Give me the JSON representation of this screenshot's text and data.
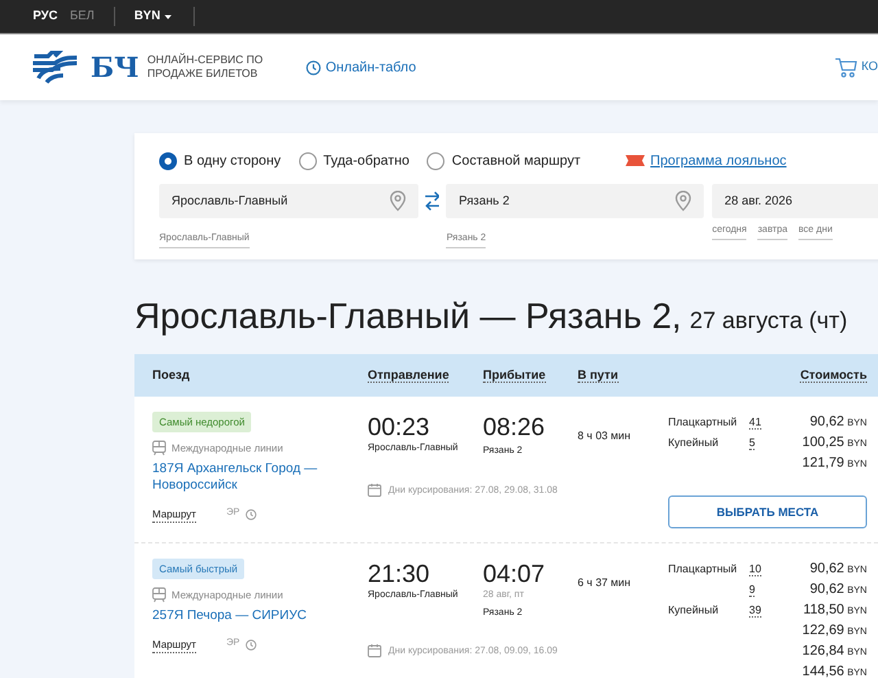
{
  "topbar": {
    "languages": [
      {
        "label": "РУС",
        "selected": true
      },
      {
        "label": "БЕЛ",
        "selected": false
      }
    ],
    "currency": "BYN"
  },
  "header": {
    "logo_text": "БЧ",
    "service": "ОНЛАЙН-СЕРВИС ПО ПРОДАЖЕ БИЛЕТОВ",
    "board_link": "Онлайн-табло",
    "cart": "КО"
  },
  "search": {
    "trip_types": [
      {
        "label": "В одну сторону",
        "selected": true
      },
      {
        "label": "Туда-обратно",
        "selected": false
      },
      {
        "label": "Составной маршрут",
        "selected": false
      }
    ],
    "loyalty_link": "Программа лояльнос",
    "from": {
      "value": "Ярославль-Главный",
      "hint": "Ярославль-Главный"
    },
    "to": {
      "value": "Рязань 2",
      "hint": "Рязань 2"
    },
    "date": {
      "value": "28 авг. 2026",
      "quick": [
        "сегодня",
        "завтра",
        "все дни"
      ]
    }
  },
  "title": {
    "route": "Ярославль-Главный — Рязань 2,",
    "date": "27 августа (чт)"
  },
  "table": {
    "columns": [
      "Поезд",
      "Отправление",
      "Прибытие",
      "В пути",
      "Стоимость"
    ],
    "rows": [
      {
        "badge": "Самый недорогой",
        "kind": "cheap",
        "line": "Международные линии",
        "train": "187Я Архангельск Город — Новороссийск",
        "route_link": "Маршрут",
        "er": "ЭР",
        "dep_time": "00:23",
        "dep_station": "Ярославль-Главный",
        "arr_time": "08:26",
        "arr_station": "Рязань 2",
        "days": "Дни курсирования: 27.08, 29.08, 31.08",
        "duration": "8 ч 03 мин",
        "button": "ВЫБРАТЬ МЕСТА",
        "fares": [
          {
            "class": "Плацкартный",
            "seats": "41",
            "price": "90,62",
            "currency": "BYN"
          },
          {
            "class": "Купейный",
            "seats": "5",
            "price": "100,25",
            "currency": "BYN"
          },
          {
            "price": "121,79",
            "currency": "BYN"
          }
        ]
      },
      {
        "badge": "Самый быстрый",
        "kind": "fast",
        "line": "Международные линии",
        "train": "257Я Печора — СИРИУС",
        "route_link": "Маршрут",
        "er": "ЭР",
        "dep_time": "21:30",
        "dep_station": "Ярославль-Главный",
        "arr_time": "04:07",
        "arr_date": "28 авг, пт",
        "arr_station": "Рязань 2",
        "days": "Дни курсирования: 27.08, 09.09, 16.09",
        "duration": "6 ч 37 мин",
        "fares": [
          {
            "class": "Плацкартный",
            "seats": "10",
            "price": "90,62",
            "currency": "BYN"
          },
          {
            "seats": "9",
            "price": "90,62",
            "currency": "BYN"
          },
          {
            "class": "Купейный",
            "seats": "39",
            "price": "118,50",
            "currency": "BYN"
          },
          {
            "price": "122,69",
            "currency": "BYN"
          },
          {
            "price": "126,84",
            "currency": "BYN"
          },
          {
            "price": "144,56",
            "currency": "BYN"
          }
        ]
      }
    ]
  }
}
